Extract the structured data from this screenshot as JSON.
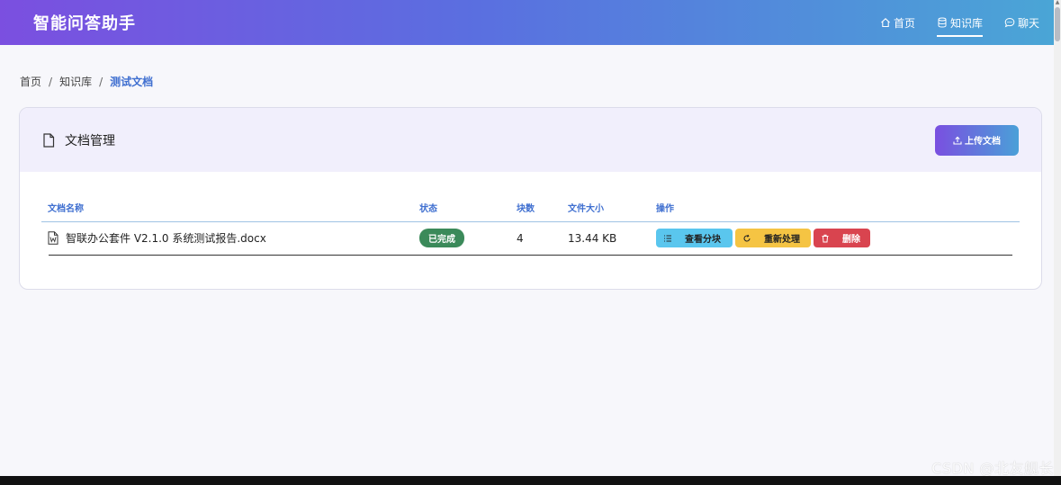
{
  "app": {
    "brand": "智能问答助手"
  },
  "nav": {
    "items": [
      {
        "label": "首页",
        "icon": "home-icon"
      },
      {
        "label": "知识库",
        "icon": "database-icon",
        "active": true
      },
      {
        "label": "聊天",
        "icon": "chat-icon"
      }
    ]
  },
  "breadcrumb": {
    "items": [
      "首页",
      "知识库"
    ],
    "current": "测试文档"
  },
  "card": {
    "title": "文档管理",
    "upload_label": "上传文档"
  },
  "table": {
    "columns": [
      "文档名称",
      "状态",
      "块数",
      "文件大小",
      "操作"
    ],
    "rows": [
      {
        "name": "智联办公套件 V2.1.0 系统测试报告.docx",
        "status": "已完成",
        "chunks": "4",
        "size": "13.44 KB",
        "actions": {
          "view": "查看分块",
          "reprocess": "重新处理",
          "delete": "删除"
        }
      }
    ]
  },
  "watermark": "CSDN @北友舰长",
  "colors": {
    "accent_start": "#7b4fe0",
    "accent_end": "#4aa6d6",
    "link": "#3f6fd0",
    "success": "#3b8a5a",
    "info": "#5ac6ee",
    "warning": "#f5c443",
    "danger": "#d9444f"
  }
}
